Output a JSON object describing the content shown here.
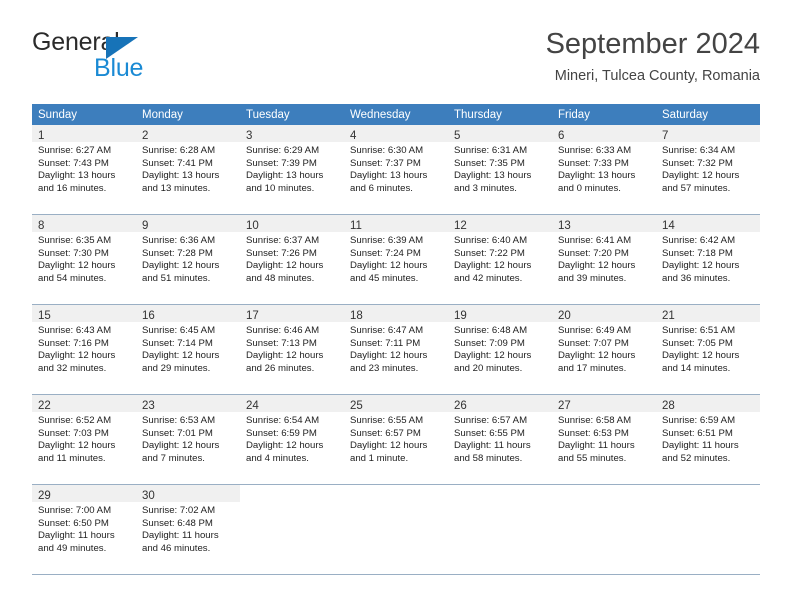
{
  "brand": {
    "name_part1": "General",
    "name_part2": "Blue",
    "accent_color": "#1a8ad4",
    "triangle_color": "#1773b8"
  },
  "header": {
    "title": "September 2024",
    "subtitle": "Mineri, Tulcea County, Romania"
  },
  "theme": {
    "header_row_bg": "#3d7ebd",
    "daynum_bar_bg": "#f0f0f0",
    "row_divider": "#9aafc4",
    "text_color": "#333333"
  },
  "weekdays": [
    "Sunday",
    "Monday",
    "Tuesday",
    "Wednesday",
    "Thursday",
    "Friday",
    "Saturday"
  ],
  "weeks": [
    [
      {
        "day": "1",
        "sunrise": "Sunrise: 6:27 AM",
        "sunset": "Sunset: 7:43 PM",
        "daylight1": "Daylight: 13 hours",
        "daylight2": "and 16 minutes."
      },
      {
        "day": "2",
        "sunrise": "Sunrise: 6:28 AM",
        "sunset": "Sunset: 7:41 PM",
        "daylight1": "Daylight: 13 hours",
        "daylight2": "and 13 minutes."
      },
      {
        "day": "3",
        "sunrise": "Sunrise: 6:29 AM",
        "sunset": "Sunset: 7:39 PM",
        "daylight1": "Daylight: 13 hours",
        "daylight2": "and 10 minutes."
      },
      {
        "day": "4",
        "sunrise": "Sunrise: 6:30 AM",
        "sunset": "Sunset: 7:37 PM",
        "daylight1": "Daylight: 13 hours",
        "daylight2": "and 6 minutes."
      },
      {
        "day": "5",
        "sunrise": "Sunrise: 6:31 AM",
        "sunset": "Sunset: 7:35 PM",
        "daylight1": "Daylight: 13 hours",
        "daylight2": "and 3 minutes."
      },
      {
        "day": "6",
        "sunrise": "Sunrise: 6:33 AM",
        "sunset": "Sunset: 7:33 PM",
        "daylight1": "Daylight: 13 hours",
        "daylight2": "and 0 minutes."
      },
      {
        "day": "7",
        "sunrise": "Sunrise: 6:34 AM",
        "sunset": "Sunset: 7:32 PM",
        "daylight1": "Daylight: 12 hours",
        "daylight2": "and 57 minutes."
      }
    ],
    [
      {
        "day": "8",
        "sunrise": "Sunrise: 6:35 AM",
        "sunset": "Sunset: 7:30 PM",
        "daylight1": "Daylight: 12 hours",
        "daylight2": "and 54 minutes."
      },
      {
        "day": "9",
        "sunrise": "Sunrise: 6:36 AM",
        "sunset": "Sunset: 7:28 PM",
        "daylight1": "Daylight: 12 hours",
        "daylight2": "and 51 minutes."
      },
      {
        "day": "10",
        "sunrise": "Sunrise: 6:37 AM",
        "sunset": "Sunset: 7:26 PM",
        "daylight1": "Daylight: 12 hours",
        "daylight2": "and 48 minutes."
      },
      {
        "day": "11",
        "sunrise": "Sunrise: 6:39 AM",
        "sunset": "Sunset: 7:24 PM",
        "daylight1": "Daylight: 12 hours",
        "daylight2": "and 45 minutes."
      },
      {
        "day": "12",
        "sunrise": "Sunrise: 6:40 AM",
        "sunset": "Sunset: 7:22 PM",
        "daylight1": "Daylight: 12 hours",
        "daylight2": "and 42 minutes."
      },
      {
        "day": "13",
        "sunrise": "Sunrise: 6:41 AM",
        "sunset": "Sunset: 7:20 PM",
        "daylight1": "Daylight: 12 hours",
        "daylight2": "and 39 minutes."
      },
      {
        "day": "14",
        "sunrise": "Sunrise: 6:42 AM",
        "sunset": "Sunset: 7:18 PM",
        "daylight1": "Daylight: 12 hours",
        "daylight2": "and 36 minutes."
      }
    ],
    [
      {
        "day": "15",
        "sunrise": "Sunrise: 6:43 AM",
        "sunset": "Sunset: 7:16 PM",
        "daylight1": "Daylight: 12 hours",
        "daylight2": "and 32 minutes."
      },
      {
        "day": "16",
        "sunrise": "Sunrise: 6:45 AM",
        "sunset": "Sunset: 7:14 PM",
        "daylight1": "Daylight: 12 hours",
        "daylight2": "and 29 minutes."
      },
      {
        "day": "17",
        "sunrise": "Sunrise: 6:46 AM",
        "sunset": "Sunset: 7:13 PM",
        "daylight1": "Daylight: 12 hours",
        "daylight2": "and 26 minutes."
      },
      {
        "day": "18",
        "sunrise": "Sunrise: 6:47 AM",
        "sunset": "Sunset: 7:11 PM",
        "daylight1": "Daylight: 12 hours",
        "daylight2": "and 23 minutes."
      },
      {
        "day": "19",
        "sunrise": "Sunrise: 6:48 AM",
        "sunset": "Sunset: 7:09 PM",
        "daylight1": "Daylight: 12 hours",
        "daylight2": "and 20 minutes."
      },
      {
        "day": "20",
        "sunrise": "Sunrise: 6:49 AM",
        "sunset": "Sunset: 7:07 PM",
        "daylight1": "Daylight: 12 hours",
        "daylight2": "and 17 minutes."
      },
      {
        "day": "21",
        "sunrise": "Sunrise: 6:51 AM",
        "sunset": "Sunset: 7:05 PM",
        "daylight1": "Daylight: 12 hours",
        "daylight2": "and 14 minutes."
      }
    ],
    [
      {
        "day": "22",
        "sunrise": "Sunrise: 6:52 AM",
        "sunset": "Sunset: 7:03 PM",
        "daylight1": "Daylight: 12 hours",
        "daylight2": "and 11 minutes."
      },
      {
        "day": "23",
        "sunrise": "Sunrise: 6:53 AM",
        "sunset": "Sunset: 7:01 PM",
        "daylight1": "Daylight: 12 hours",
        "daylight2": "and 7 minutes."
      },
      {
        "day": "24",
        "sunrise": "Sunrise: 6:54 AM",
        "sunset": "Sunset: 6:59 PM",
        "daylight1": "Daylight: 12 hours",
        "daylight2": "and 4 minutes."
      },
      {
        "day": "25",
        "sunrise": "Sunrise: 6:55 AM",
        "sunset": "Sunset: 6:57 PM",
        "daylight1": "Daylight: 12 hours",
        "daylight2": "and 1 minute."
      },
      {
        "day": "26",
        "sunrise": "Sunrise: 6:57 AM",
        "sunset": "Sunset: 6:55 PM",
        "daylight1": "Daylight: 11 hours",
        "daylight2": "and 58 minutes."
      },
      {
        "day": "27",
        "sunrise": "Sunrise: 6:58 AM",
        "sunset": "Sunset: 6:53 PM",
        "daylight1": "Daylight: 11 hours",
        "daylight2": "and 55 minutes."
      },
      {
        "day": "28",
        "sunrise": "Sunrise: 6:59 AM",
        "sunset": "Sunset: 6:51 PM",
        "daylight1": "Daylight: 11 hours",
        "daylight2": "and 52 minutes."
      }
    ],
    [
      {
        "day": "29",
        "sunrise": "Sunrise: 7:00 AM",
        "sunset": "Sunset: 6:50 PM",
        "daylight1": "Daylight: 11 hours",
        "daylight2": "and 49 minutes."
      },
      {
        "day": "30",
        "sunrise": "Sunrise: 7:02 AM",
        "sunset": "Sunset: 6:48 PM",
        "daylight1": "Daylight: 11 hours",
        "daylight2": "and 46 minutes."
      },
      {
        "day": "",
        "sunrise": "",
        "sunset": "",
        "daylight1": "",
        "daylight2": ""
      },
      {
        "day": "",
        "sunrise": "",
        "sunset": "",
        "daylight1": "",
        "daylight2": ""
      },
      {
        "day": "",
        "sunrise": "",
        "sunset": "",
        "daylight1": "",
        "daylight2": ""
      },
      {
        "day": "",
        "sunrise": "",
        "sunset": "",
        "daylight1": "",
        "daylight2": ""
      },
      {
        "day": "",
        "sunrise": "",
        "sunset": "",
        "daylight1": "",
        "daylight2": ""
      }
    ]
  ]
}
